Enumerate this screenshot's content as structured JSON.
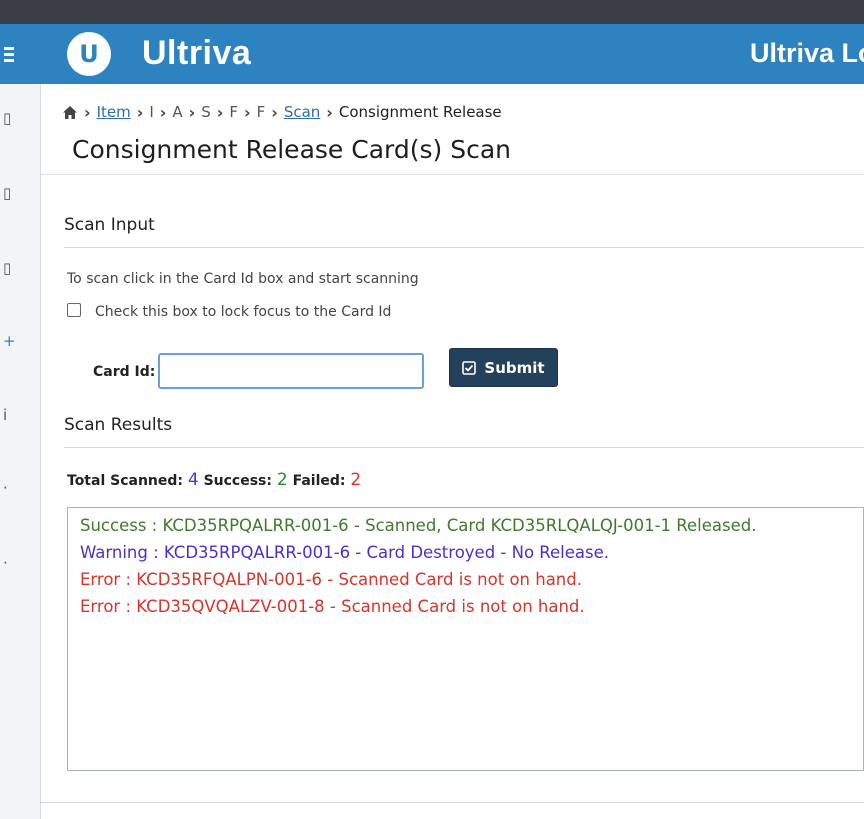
{
  "header": {
    "logo_letter": "U",
    "app_name": "Ultriva",
    "right_title": "Ultriva Lo"
  },
  "breadcrumb": {
    "items": [
      "Item",
      "I",
      "A",
      "S",
      "F",
      "F",
      "Scan"
    ],
    "current": "Consignment Release"
  },
  "page": {
    "title": "Consignment Release Card(s) Scan"
  },
  "scan_input": {
    "title": "Scan Input",
    "hint": "To scan click in the Card Id box and start scanning",
    "lock_label": "Check this box to lock focus to the Card Id",
    "card_label": "Card Id:",
    "card_value": "",
    "submit_label": "Submit"
  },
  "scan_results": {
    "title": "Scan Results",
    "total_label": "Total Scanned:",
    "total_value": "4",
    "success_label": "Success:",
    "success_value": "2",
    "failed_label": "Failed:",
    "failed_value": "2",
    "lines": [
      {
        "status": "success",
        "text": "Success : KCD35RPQALRR-001-6 - Scanned, Card KCD35RLQALQJ-001-1 Released."
      },
      {
        "status": "warning",
        "text": "Warning : KCD35RPQALRR-001-6 - Card Destroyed - No Release."
      },
      {
        "status": "error",
        "text": "Error : KCD35RFQALPN-001-6 - Scanned Card is not on hand."
      },
      {
        "status": "error",
        "text": "Error : KCD35QVQALZV-001-8 - Scanned Card is not on hand."
      }
    ]
  },
  "colors": {
    "header_blue": "#2d83bf",
    "submit_dark": "#23415a",
    "success": "#3e7a2a",
    "warning": "#4a2fd1",
    "error": "#d9342a"
  },
  "icons": {
    "menu": "hamburger-icon",
    "home": "home-icon",
    "submit": "check-square-icon"
  }
}
